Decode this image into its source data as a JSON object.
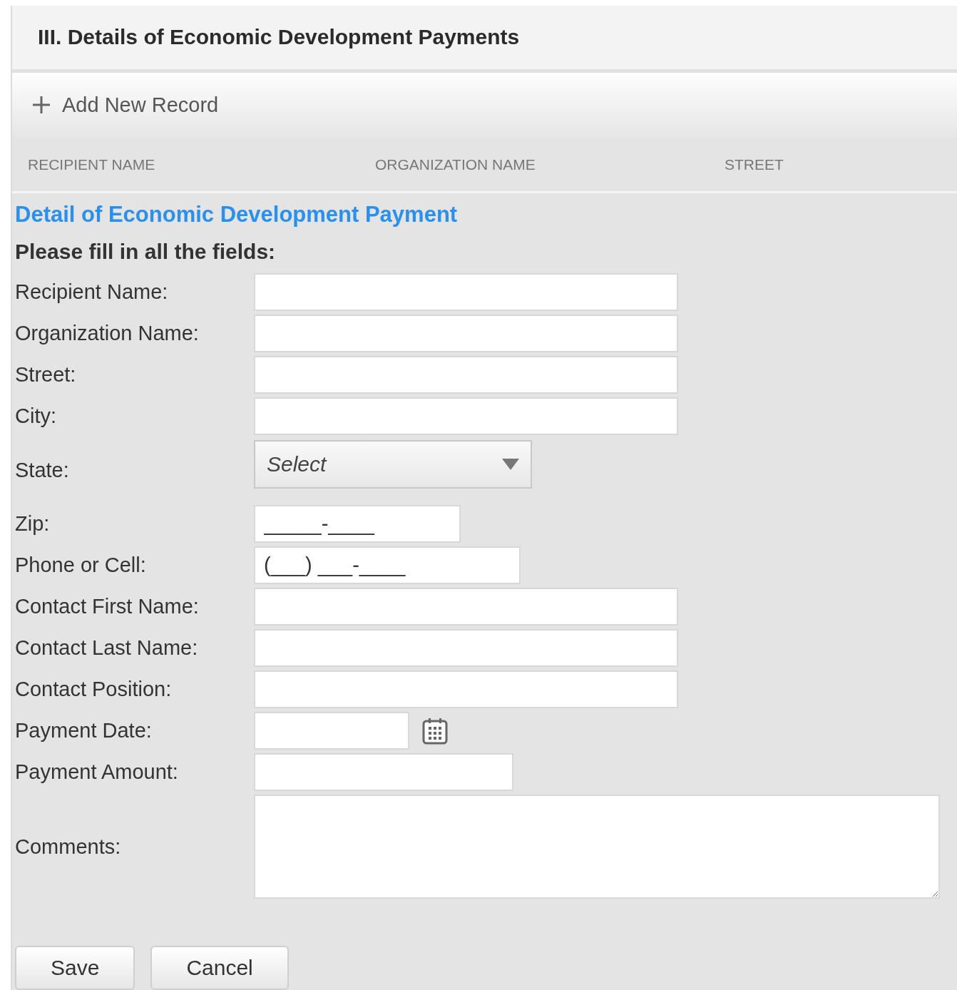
{
  "section_title": "III. Details of Economic Development Payments",
  "toolbar": {
    "add_button": "Add New Record"
  },
  "table": {
    "columns": [
      "RECIPIENT NAME",
      "ORGANIZATION NAME",
      "STREET"
    ]
  },
  "form": {
    "title": "Detail of Economic Development Payment",
    "instruction": "Please fill in all the fields:",
    "fields": [
      {
        "label": "Recipient Name:",
        "kind": "text"
      },
      {
        "label": "Organization Name:",
        "kind": "text"
      },
      {
        "label": "Street:",
        "kind": "text"
      },
      {
        "label": "City:",
        "kind": "text"
      },
      {
        "label": "State:",
        "kind": "select",
        "placeholder": "Select"
      },
      {
        "label": "Zip:",
        "kind": "mask",
        "value": "_____-____"
      },
      {
        "label": "Phone or Cell:",
        "kind": "mask",
        "value": "(___) ___-____"
      },
      {
        "label": "Contact First Name:",
        "kind": "text"
      },
      {
        "label": "Contact Last Name:",
        "kind": "text"
      },
      {
        "label": "Contact Position:",
        "kind": "text"
      },
      {
        "label": "Payment Date:",
        "kind": "date"
      },
      {
        "label": "Payment Amount:",
        "kind": "amount"
      },
      {
        "label": "Comments:",
        "kind": "textarea"
      }
    ],
    "buttons": [
      "Save",
      "Cancel"
    ]
  }
}
